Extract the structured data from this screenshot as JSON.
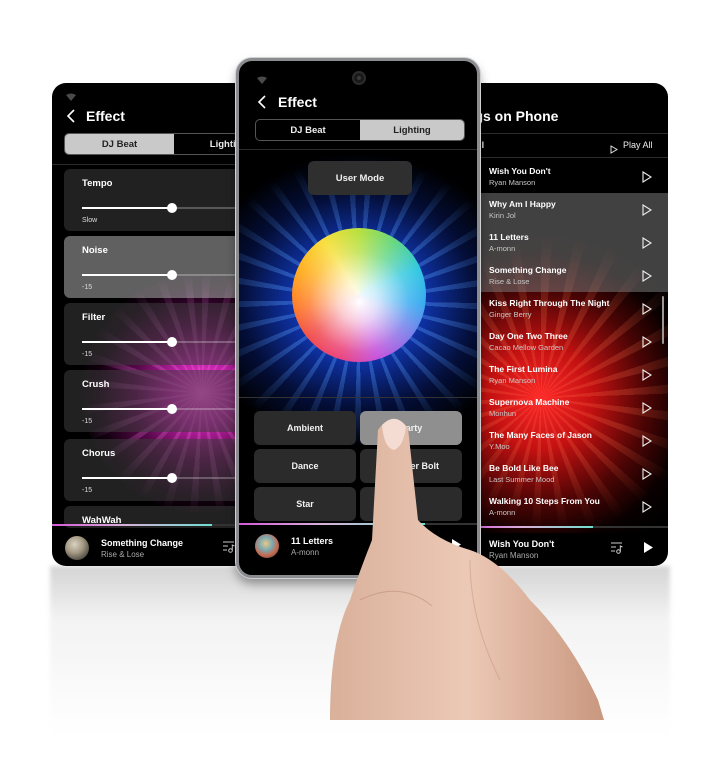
{
  "left_phone": {
    "title": "Effect",
    "tabs": [
      {
        "label": "DJ Beat",
        "active": true
      },
      {
        "label": "Lighting",
        "active": false
      }
    ],
    "effects": [
      {
        "name": "Tempo",
        "value_label": "Slow",
        "slider_percent": 50
      },
      {
        "name": "Noise",
        "value_label": "-15",
        "slider_percent": 50
      },
      {
        "name": "Filter",
        "value_label": "-15",
        "slider_percent": 50
      },
      {
        "name": "Crush",
        "value_label": "-15",
        "slider_percent": 50
      },
      {
        "name": "Chorus",
        "value_label": "-15",
        "slider_percent": 50
      },
      {
        "name": "WahWah",
        "value_label": "",
        "slider_percent": 50
      }
    ],
    "glow_color": "#e030c8",
    "now_playing": {
      "title": "Something Change",
      "artist": "Rise & Lose",
      "progress_percent": 80
    }
  },
  "center_phone": {
    "title": "Effect",
    "tabs": [
      {
        "label": "DJ Beat",
        "active": false
      },
      {
        "label": "Lighting",
        "active": true
      }
    ],
    "user_mode_label": "User Mode",
    "glow_color": "#2a6cff",
    "modes": [
      {
        "label": "Ambient",
        "active": false
      },
      {
        "label": "Party",
        "active": true
      },
      {
        "label": "Dance",
        "active": false
      },
      {
        "label": "Thunder Bolt",
        "active": false
      },
      {
        "label": "Star",
        "active": false
      },
      {
        "label": "",
        "active": false
      }
    ],
    "now_playing": {
      "title": "11 Letters",
      "artist": "A-monn",
      "progress_percent": 78
    }
  },
  "right_phone": {
    "title": "Songs on Phone",
    "select_all_label": "Select All",
    "play_all_label": "Play All",
    "glow_color": "#e82020",
    "songs": [
      {
        "title": "Wish You Don't",
        "artist": "Ryan Manson"
      },
      {
        "title": "Why Am I Happy",
        "artist": "Kirin Jol"
      },
      {
        "title": "11 Letters",
        "artist": "A-monn"
      },
      {
        "title": "Something Change",
        "artist": "Rise & Lose"
      },
      {
        "title": "Kiss Right Through The Night",
        "artist": "Ginger Berry"
      },
      {
        "title": "Day One Two Three",
        "artist": "Cacao Mellow Garden"
      },
      {
        "title": "The First Lumina",
        "artist": "Ryan Manson"
      },
      {
        "title": "Supernova Machine",
        "artist": "Monhun"
      },
      {
        "title": "The Many Faces of Jason",
        "artist": "Y.Moo"
      },
      {
        "title": "Be Bold Like Bee",
        "artist": "Last Summer Mood"
      },
      {
        "title": "Walking 10 Steps From You",
        "artist": "A-monn"
      }
    ],
    "now_playing": {
      "title": "Wish You Don't",
      "artist": "Ryan Manson",
      "progress_percent": 63
    }
  }
}
